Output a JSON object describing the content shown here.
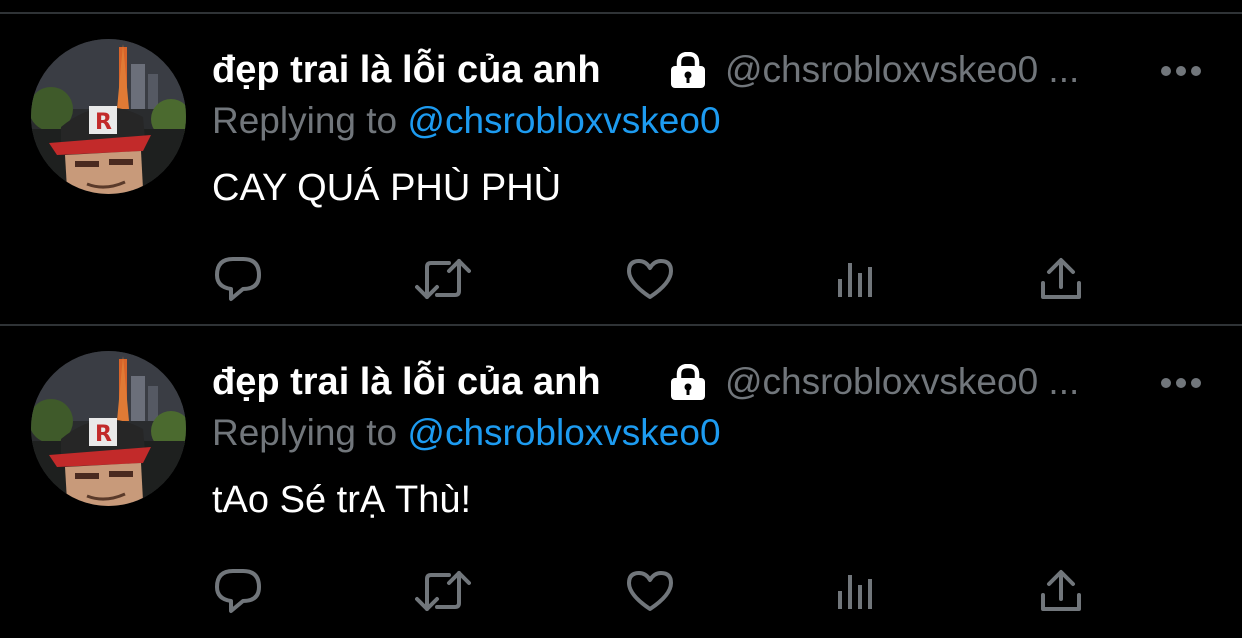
{
  "tweets": [
    {
      "display_name": "đẹp trai là lỗi của anh",
      "handle": "@chsrobloxvskeo0 ...",
      "replying_prefix": "Replying to ",
      "replying_handle": "@chsrobloxvskeo0",
      "text": "CAY QUÁ PHÙ PHÙ",
      "icons": {
        "lock": "lock-icon",
        "more": "more-icon",
        "reply": "reply-icon",
        "retweet": "retweet-icon",
        "like": "heart-icon",
        "stats": "stats-icon",
        "share": "share-icon"
      }
    },
    {
      "display_name": "đẹp trai là lỗi của anh",
      "handle": "@chsrobloxvskeo0 ...",
      "replying_prefix": "Replying to ",
      "replying_handle": "@chsrobloxvskeo0",
      "text": "tAo Sé trẠ Thù!",
      "icons": {
        "lock": "lock-icon",
        "more": "more-icon",
        "reply": "reply-icon",
        "retweet": "retweet-icon",
        "like": "heart-icon",
        "stats": "stats-icon",
        "share": "share-icon"
      }
    }
  ],
  "colors": {
    "background": "#000000",
    "display_name": "#ffffff",
    "secondary_text": "#71767b",
    "link": "#1d9bf0",
    "divider": "#2f3336",
    "icon": "#71767b"
  }
}
